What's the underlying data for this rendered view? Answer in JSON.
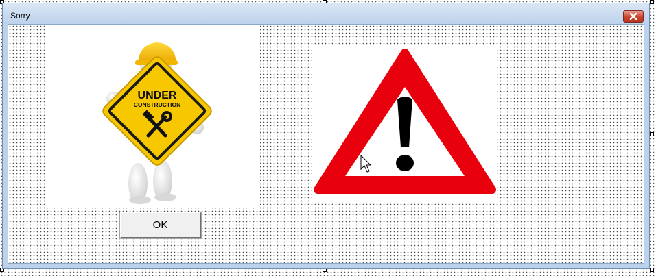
{
  "window": {
    "title": "Sorry",
    "close_icon": "close-icon"
  },
  "images": {
    "construction": {
      "icon": "under-construction-figure-icon",
      "sign_line1": "UNDER",
      "sign_line2": "CONSTRUCTION"
    },
    "warning": {
      "icon": "warning-triangle-icon"
    }
  },
  "buttons": {
    "ok_label": "OK"
  },
  "colors": {
    "warning_red": "#e8000d",
    "sign_yellow": "#f7c800",
    "close_red": "#c9472f",
    "titlebar": "#c9daf0"
  }
}
